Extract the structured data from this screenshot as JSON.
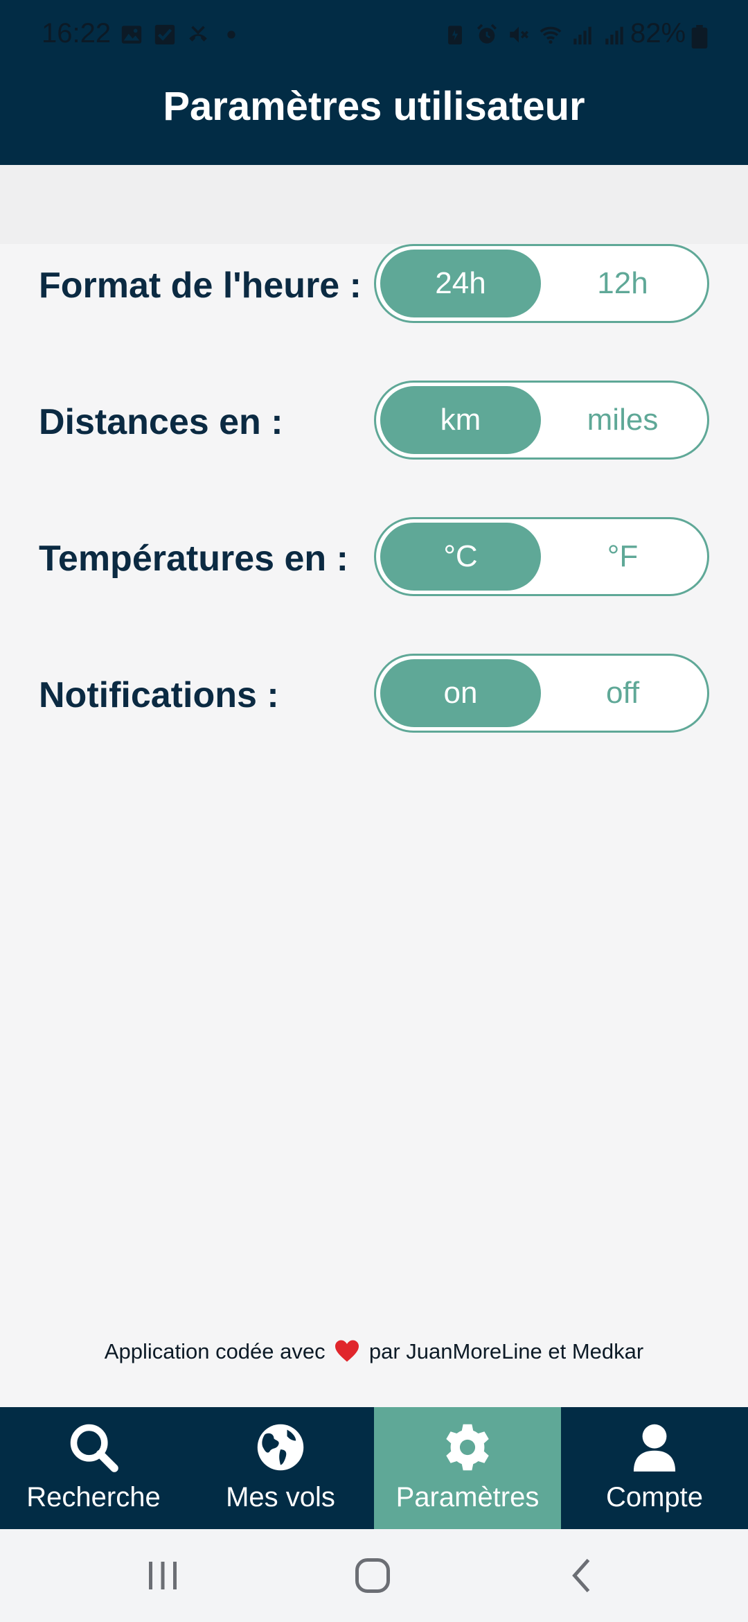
{
  "status_bar": {
    "time": "16:22",
    "battery": "82%"
  },
  "header": {
    "title": "Paramètres utilisateur"
  },
  "settings": [
    {
      "label": "Format de l'heure :",
      "options": [
        "24h",
        "12h"
      ],
      "selected": "24h"
    },
    {
      "label": "Distances en :",
      "options": [
        "km",
        "miles"
      ],
      "selected": "km"
    },
    {
      "label": "Températures en :",
      "options": [
        "°C",
        "°F"
      ],
      "selected": "°C"
    },
    {
      "label": "Notifications :",
      "options": [
        "on",
        "off"
      ],
      "selected": "on"
    }
  ],
  "footer": {
    "credit_before": "Application codée avec",
    "credit_after": "par JuanMoreLine et Medkar"
  },
  "nav": {
    "items": [
      {
        "label": "Recherche",
        "icon": "search-icon"
      },
      {
        "label": "Mes vols",
        "icon": "globe-icon"
      },
      {
        "label": "Paramètres",
        "icon": "gear-icon"
      },
      {
        "label": "Compte",
        "icon": "user-icon"
      }
    ],
    "active": "Paramètres"
  },
  "colors": {
    "header_bg": "#022c45",
    "accent": "#5fa897",
    "label_text": "#0b2a42",
    "page_bg": "#f5f5f6"
  }
}
